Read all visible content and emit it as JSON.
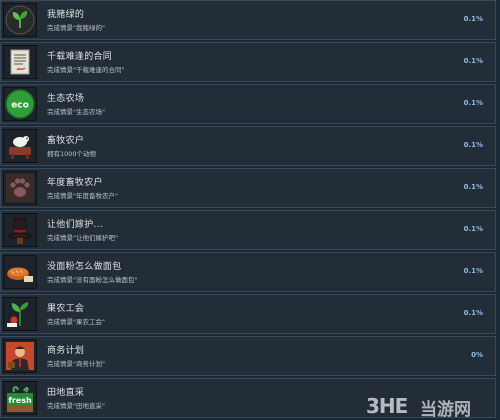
{
  "achievements": [
    {
      "title": "我赌绿的",
      "desc": "完成情景\"我赌绿的\"",
      "percent": "0.1%",
      "icon": "sprout-icon"
    },
    {
      "title": "千载难逢的合同",
      "desc": "完成情景\"千载难逢的合同\"",
      "percent": "0.1%",
      "icon": "contract-icon"
    },
    {
      "title": "生态农场",
      "desc": "完成情景\"生态农场\"",
      "percent": "0.1%",
      "icon": "eco-badge-icon"
    },
    {
      "title": "畜牧农户",
      "desc": "拥有1000个动物",
      "percent": "0.1%",
      "icon": "animals-icon"
    },
    {
      "title": "年度畜牧农户",
      "desc": "完成情景\"年度畜牧农户\"",
      "percent": "0.1%",
      "icon": "paw-icon"
    },
    {
      "title": "让他们嫁护...",
      "desc": "完成情景\"让他们嫁护吧\"",
      "percent": "0.1%",
      "icon": "top-hat-icon"
    },
    {
      "title": "没面粉怎么做面包",
      "desc": "完成情景\"没有面粉怎么做面包\"",
      "percent": "0.1%",
      "icon": "bread-icon"
    },
    {
      "title": "果农工会",
      "desc": "完成情景\"果农工会\"",
      "percent": "0.1%",
      "icon": "fruit-plant-icon"
    },
    {
      "title": "商务计划",
      "desc": "完成情景\"商务计划\"",
      "percent": "0%",
      "icon": "businessman-icon"
    },
    {
      "title": "田地直采",
      "desc": "完成情景\"田地直采\"",
      "percent": "",
      "icon": "fresh-crate-icon"
    }
  ],
  "watermark": {
    "logo": "3HE",
    "text": "当游网"
  }
}
